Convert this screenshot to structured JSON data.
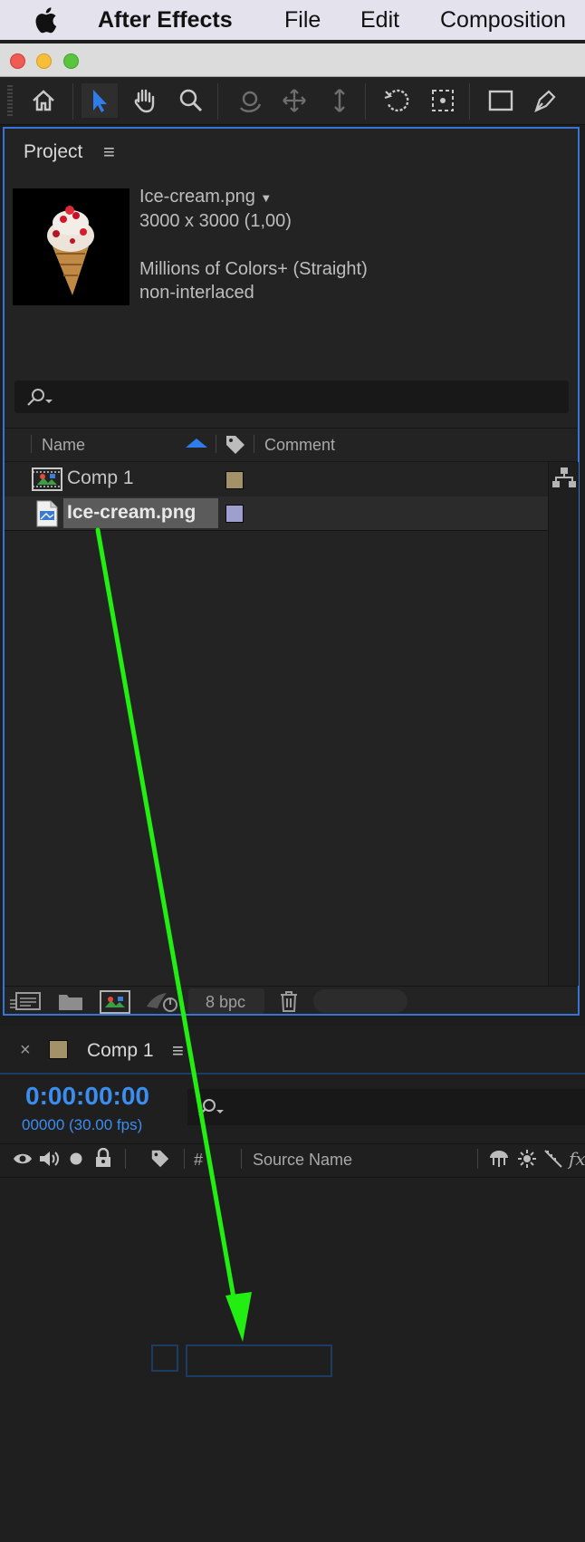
{
  "menubar": {
    "app_name": "After Effects",
    "items": [
      "File",
      "Edit",
      "Composition"
    ]
  },
  "project_panel": {
    "title": "Project",
    "preview": {
      "filename": "Ice-cream.png",
      "dimensions": "3000 x 3000 (1,00)",
      "color_info": "Millions of Colors+ (Straight)",
      "interlace": "non-interlaced"
    },
    "columns": {
      "name": "Name",
      "comment": "Comment"
    },
    "items": [
      {
        "name": "Comp 1",
        "label_color": "#a3916a",
        "type": "composition"
      },
      {
        "name": "Ice-cream.png",
        "label_color": "#9f9fcf",
        "type": "image",
        "selected": true
      }
    ],
    "bit_depth": "8 bpc"
  },
  "timeline_panel": {
    "tab_label": "Comp 1",
    "tab_color": "#a3916a",
    "timecode": "0:00:00:00",
    "frame_info": "00000 (30.00 fps)",
    "columns": {
      "number": "#",
      "source_name": "Source Name",
      "fx": "fx"
    }
  },
  "colors": {
    "accent_blue": "#3575d8",
    "timecode_blue": "#3b8df0",
    "drag_arrow": "#22ee11"
  }
}
